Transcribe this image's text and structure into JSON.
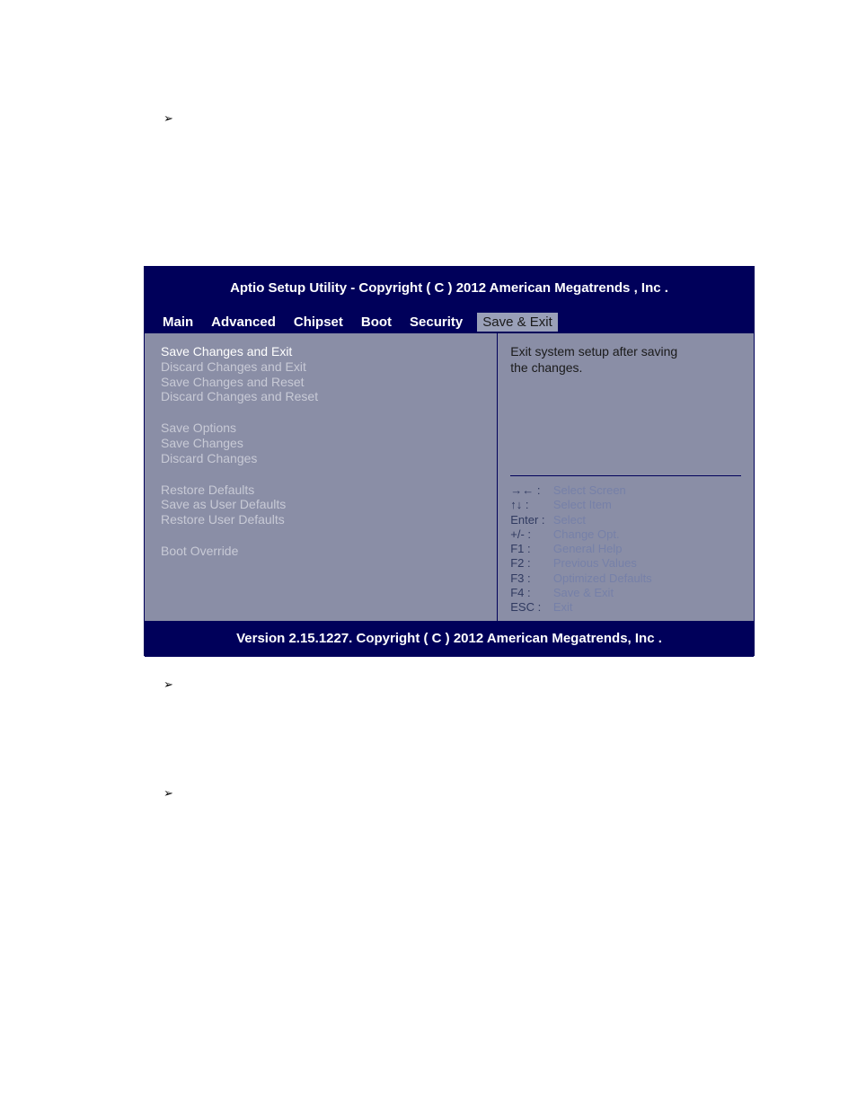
{
  "bios": {
    "title": "Aptio Setup Utility - Copyright ( C ) 2012 American Megatrends , Inc .",
    "version": "Version 2.15.1227. Copyright ( C ) 2012 American Megatrends, Inc .",
    "tabs": {
      "main": "Main",
      "advanced": "Advanced",
      "chipset": "Chipset",
      "boot": "Boot",
      "security": "Security",
      "save": "Save & Exit"
    },
    "left": {
      "save_exit": "Save Changes and Exit",
      "discard_exit": "Discard Changes and Exit",
      "save_reset": "Save Changes and Reset",
      "discard_reset": "Discard Changes and Reset",
      "save_options_hdr": "Save Options",
      "save_changes": "Save Changes",
      "discard_changes": "Discard Changes",
      "restore_defaults": "Restore Defaults",
      "save_user_defaults": "Save as User Defaults",
      "restore_user_defaults": "Restore User Defaults",
      "boot_override": "Boot Override"
    },
    "right": {
      "desc1": "Exit system setup after saving",
      "desc2": "the changes."
    },
    "help": {
      "r1k": "→← :",
      "r1v": "Select Screen",
      "r2k": "↑↓  :",
      "r2v": "Select Item",
      "r3k": "Enter :",
      "r3v": "Select",
      "r4k": "+/- :",
      "r4v": "Change Opt.",
      "r5k": "F1 :",
      "r5v": "General Help",
      "r6k": "F2 :",
      "r6v": "Previous Values",
      "r7k": "F3 :",
      "r7v": "Optimized Defaults",
      "r8k": "F4 :",
      "r8v": "Save & Exit",
      "r9k": "ESC :",
      "r9v": "Exit"
    }
  }
}
